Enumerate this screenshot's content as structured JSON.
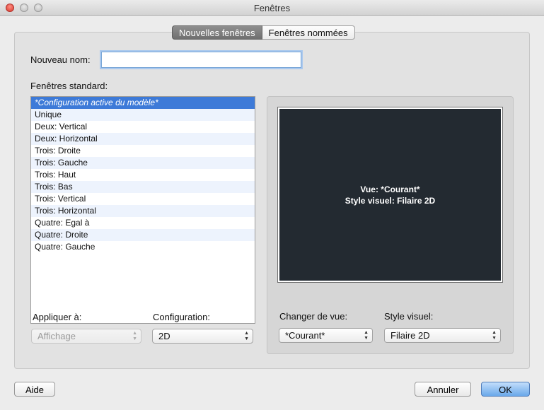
{
  "window": {
    "title": "Fenêtres"
  },
  "tabs": [
    {
      "label": "Nouvelles fenêtres",
      "active": true
    },
    {
      "label": "Fenêtres nommées",
      "active": false
    }
  ],
  "new_name": {
    "label": "Nouveau nom:",
    "value": ""
  },
  "standard": {
    "label": "Fenêtres standard:",
    "items": [
      "*Configuration active du modèle*",
      "Unique",
      "Deux: Vertical",
      "Deux: Horizontal",
      "Trois: Droite",
      "Trois: Gauche",
      "Trois: Haut",
      "Trois: Bas",
      "Trois: Vertical",
      "Trois: Horizontal",
      "Quatre: Egal à",
      "Quatre: Droite",
      "Quatre: Gauche"
    ],
    "selected_index": 0
  },
  "preview": {
    "view_text": "Vue: *Courant*",
    "style_text": "Style visuel: Filaire 2D",
    "background": "#232a31"
  },
  "apply_to": {
    "label": "Appliquer à:",
    "value": "Affichage",
    "disabled": true
  },
  "configuration": {
    "label": "Configuration:",
    "value": "2D"
  },
  "change_view": {
    "label": "Changer de vue:",
    "value": "*Courant*"
  },
  "visual_style": {
    "label": "Style visuel:",
    "value": "Filaire 2D"
  },
  "buttons": {
    "help": "Aide",
    "cancel": "Annuler",
    "ok": "OK"
  },
  "colors": {
    "selection": "#3d7ad8",
    "default_button": "#6aa8ea"
  }
}
